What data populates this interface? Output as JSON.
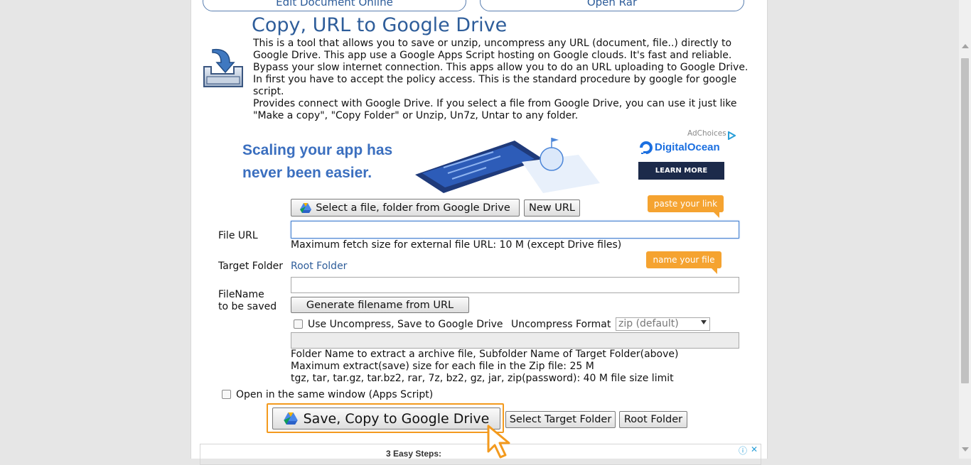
{
  "top_buttons": {
    "edit": "Edit Document Online",
    "open": "Open Rar"
  },
  "header": {
    "title": "Copy, URL to Google Drive",
    "description": [
      "This is a tool that allows you to save or unzip, uncompress any URL (document, file..) directly to",
      "Google Drive. This app use a Google Apps Script hosting on Google clouds. It's fast and reliable.",
      "Bypass your slow internet connection. This apps allow you to do an URL uploading to Google Drive.",
      "In first you have to accept the policy access. This is the standard procedure by google for google",
      "script.",
      "Provides connect with Google Drive. If you select a file from Google Drive, you can use it just like",
      "\"Make a copy\", \"Copy Folder\" or Unzip, Un7z, Untar to any folder."
    ]
  },
  "ad": {
    "headline_1": "Scaling your app has",
    "headline_2": "never been easier.",
    "adchoices": "AdChoices",
    "brand": "DigitalOcean",
    "cta": "LEARN MORE"
  },
  "picker": {
    "select_label": "Select a file, folder from Google Drive",
    "new_url_label": "New URL"
  },
  "tips": {
    "paste": "paste your link",
    "name": "name your file"
  },
  "form": {
    "file_url_label": "File URL",
    "file_url_value": "",
    "max_fetch": "Maximum fetch size for external file URL: 10 M (except Drive files)",
    "target_folder_label": "Target Folder",
    "target_folder_value": "Root Folder",
    "filename_label_1": "FileName",
    "filename_label_2": "to be saved",
    "filename_value": "",
    "generate_label": "Generate filename from URL",
    "uncompress_label": "Use Uncompress, Save to Google Drive",
    "uncompress_format_label": "Uncompress Format",
    "uncompress_format_value": "zip (default)",
    "extract_folder_value": "",
    "notes": [
      "Folder Name to extract a archive file, Subfolder Name of Target Folder(above)",
      "Maximum extract(save) size for each file in the Zip file: 25 M",
      "tgz, tar, tar.gz, tar.bz2, rar, 7z, bz2, gz, jar, zip(password): 40 M file size limit"
    ],
    "same_window_label": "Open in the same window (Apps Script)"
  },
  "actions": {
    "save_label": "Save, Copy to Google Drive",
    "select_target_label": "Select Target Folder",
    "root_folder_label": "Root Folder"
  },
  "bottom_ad": {
    "title": "3 Easy Steps:",
    "info": "ⓘ",
    "close": "✕"
  },
  "colors": {
    "accent_blue": "#2e5d9a",
    "tip_orange": "#f5a330",
    "highlight_orange": "#f39a1e",
    "ad_navy": "#1c2a4a"
  },
  "icons": [
    "download-tray-icon",
    "google-drive-icon",
    "cursor-icon",
    "digitalocean-logo-icon",
    "adchoices-icon"
  ]
}
